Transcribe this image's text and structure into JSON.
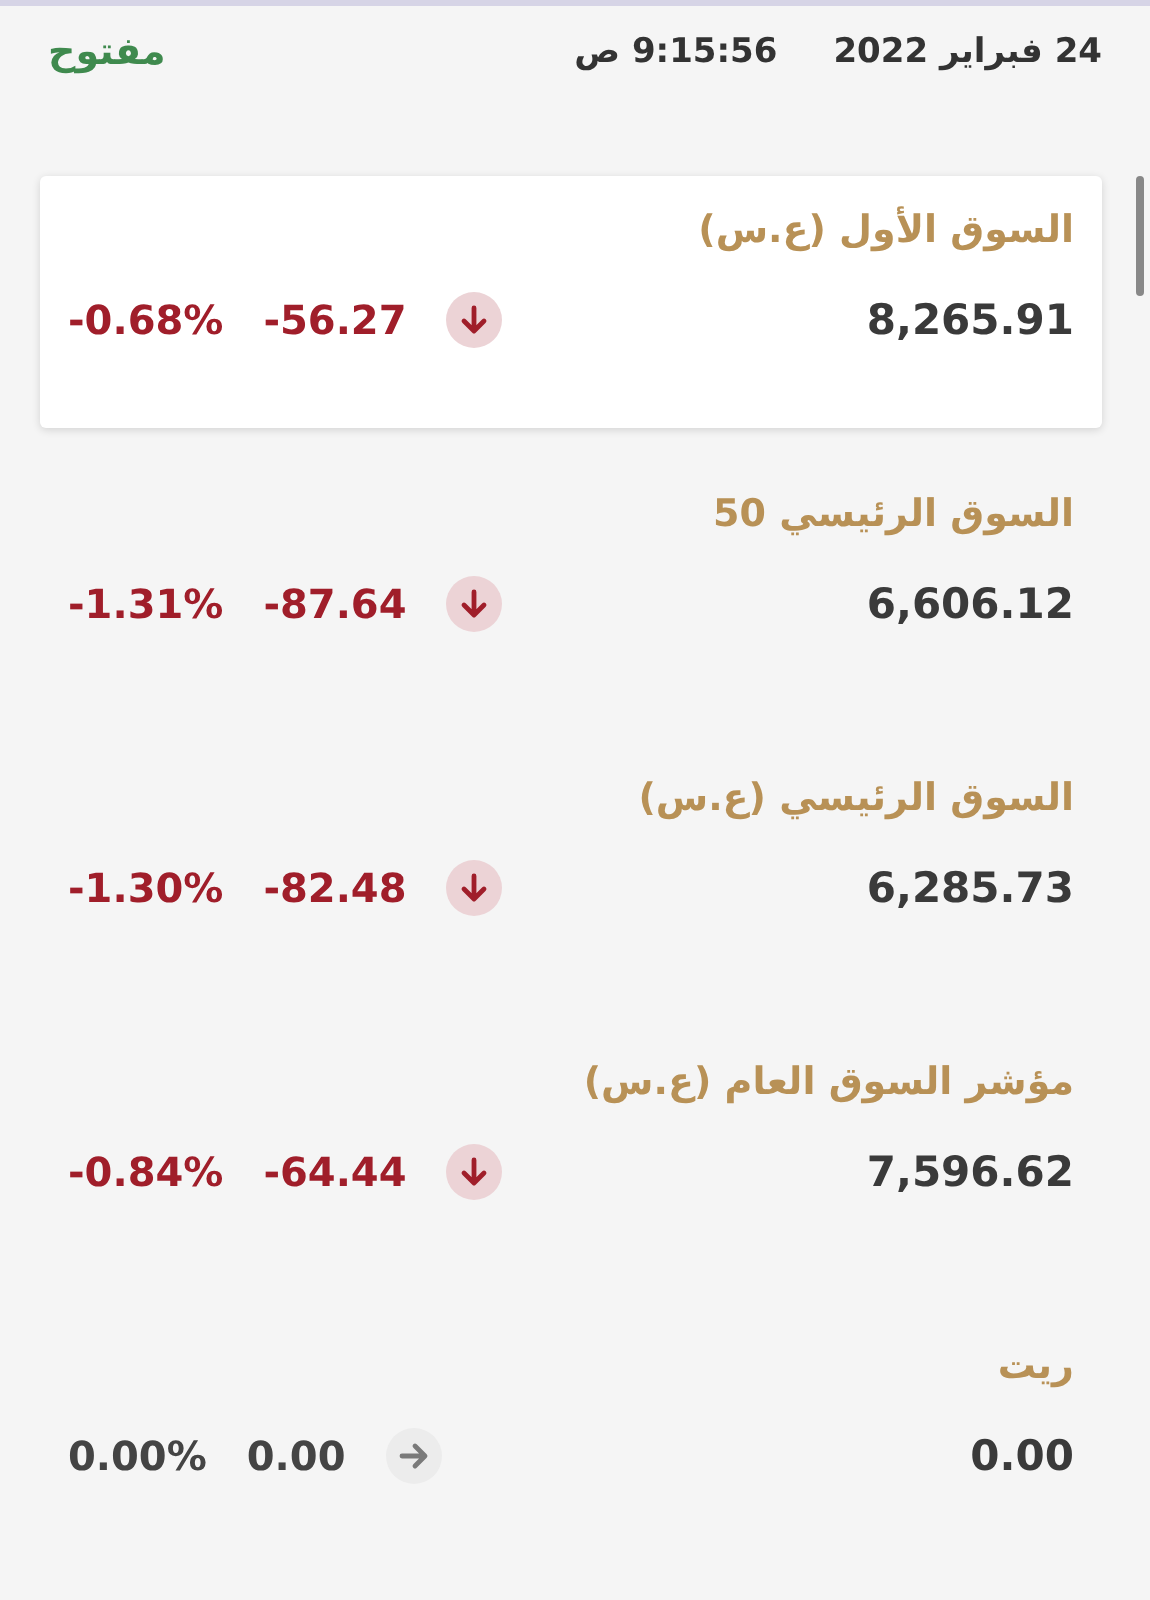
{
  "header": {
    "status": "مفتوح",
    "time": "9:15:56 ص",
    "date": "24 فبراير 2022"
  },
  "indices": [
    {
      "name": "السوق الأول (ع.س)",
      "value": "8,265.91",
      "kind": "down",
      "change": "-56.27",
      "percent": "-0.68%",
      "selected": true
    },
    {
      "name": "السوق الرئيسي 50",
      "value": "6,606.12",
      "kind": "down",
      "change": "-87.64",
      "percent": "-1.31%",
      "selected": false
    },
    {
      "name": "السوق الرئيسي (ع.س)",
      "value": "6,285.73",
      "kind": "down",
      "change": "-82.48",
      "percent": "-1.30%",
      "selected": false
    },
    {
      "name": "مؤشر السوق العام (ع.س)",
      "value": "7,596.62",
      "kind": "down",
      "change": "-64.44",
      "percent": "-0.84%",
      "selected": false
    },
    {
      "name": "ريت",
      "value": "0.00",
      "kind": "flat",
      "change": "0.00",
      "percent": "0.00%",
      "selected": false
    }
  ]
}
